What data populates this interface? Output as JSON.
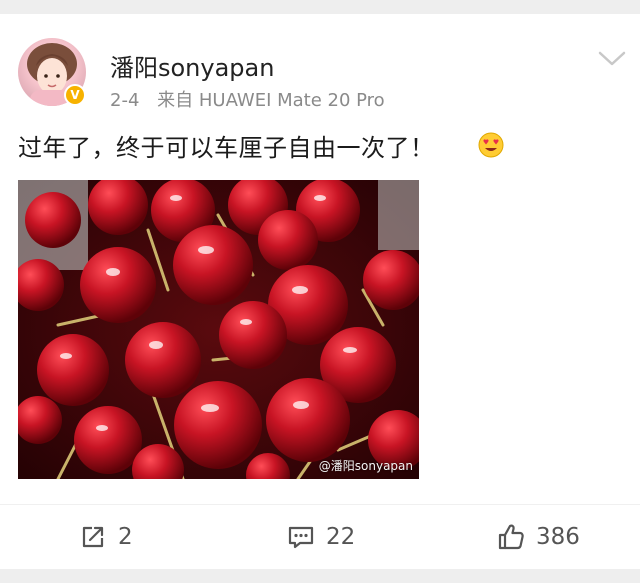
{
  "post": {
    "author": {
      "name": "潘阳sonyapan",
      "verified_badge": "V",
      "avatar_icon": "user-avatar",
      "verified_color": "#f7b200"
    },
    "date": "2-4",
    "source": "来自 HUAWEI Mate 20 Pro",
    "text": "过年了，终于可以车厘子自由一次了！",
    "emoji_icon": "heart-eyes-emoji",
    "image": {
      "description_icon": "cherries-photo",
      "watermark": "@潘阳sonyapan"
    },
    "menu_icon": "chevron-down-icon"
  },
  "actions": {
    "repost_count": "2",
    "comment_count": "22",
    "like_count": "386",
    "repost_icon": "repost-icon",
    "comment_icon": "comment-icon",
    "like_icon": "thumbs-up-icon"
  },
  "colors": {
    "background": "#eeeeee",
    "card": "#ffffff",
    "text": "#1b1b1b",
    "meta": "#8a8a8a",
    "cherry": "#b20f1c"
  }
}
